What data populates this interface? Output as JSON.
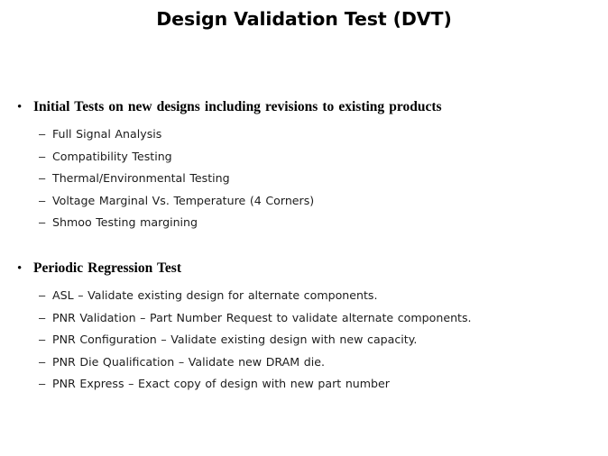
{
  "slide": {
    "title": "Design Validation Test (DVT)",
    "background_color": "#ffffff",
    "text_color": "#1c1c1c",
    "title_color": "#000000",
    "bullet_marker": "•",
    "sub_bullet_marker": "–",
    "sections": [
      {
        "heading": "Initial  Tests on new designs  including  revisions  to existing  products",
        "items": [
          "Full Signal Analysis",
          "Compatibility  Testing",
          "Thermal/Environmental  Testing",
          "Voltage Marginal  Vs. Temperature (4 Corners)",
          "Shmoo Testing margining"
        ]
      },
      {
        "heading": "Periodic  Regression  Test",
        "items": [
          "ASL – Validate existing design for alternate components.",
          "PNR Validation – Part Number Request to validate  alternate components.",
          "PNR Configuration – Validate existing design with new capacity.",
          "PNR  Die  Qualification  – Validate  new DRAM die.",
          "PNR Express – Exact copy of design with new part number"
        ]
      }
    ]
  }
}
